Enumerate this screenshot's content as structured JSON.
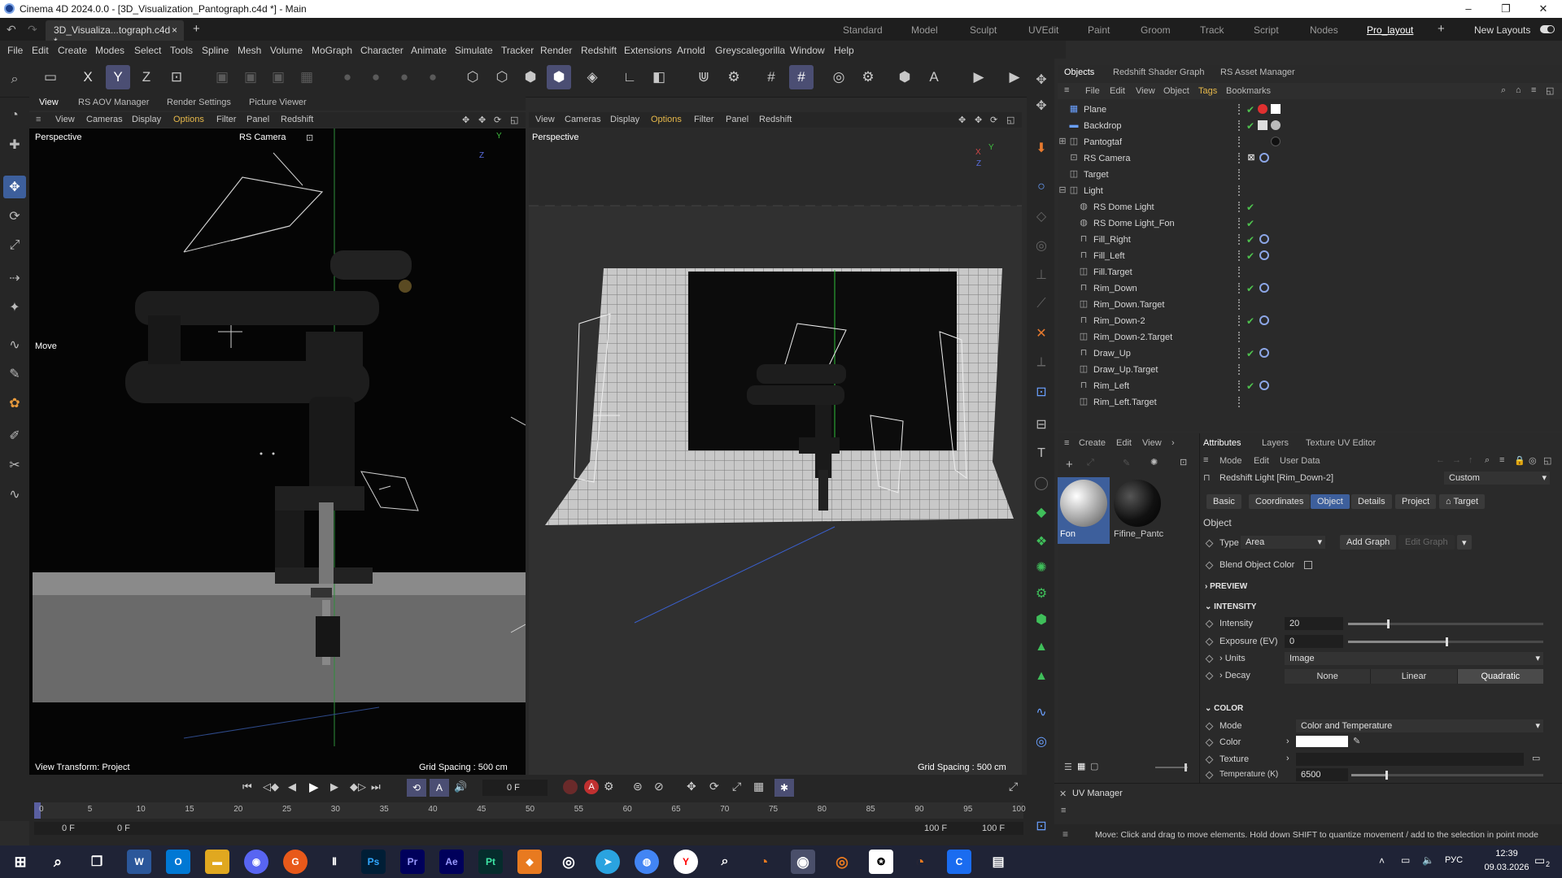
{
  "window": {
    "title": "Cinema 4D 2024.0.0 - [3D_Visualization_Pantograph.c4d *] - Main",
    "minimize": "–",
    "maximize": "❐",
    "close": "✕"
  },
  "tabs": {
    "doc_tab": "3D_Visualiza...tograph.c4d *",
    "close": "×",
    "add": "+",
    "layouts": [
      "Standard",
      "Model",
      "Sculpt",
      "UVEdit",
      "Paint",
      "Groom",
      "Track",
      "Script",
      "Nodes",
      "Pro_layout"
    ],
    "new_layouts": "New Layouts"
  },
  "menu": [
    "File",
    "Edit",
    "Create",
    "Modes",
    "Select",
    "Tools",
    "Spline",
    "Mesh",
    "Volume",
    "MoGraph",
    "Character",
    "Animate",
    "Simulate",
    "Tracker",
    "Render",
    "Redshift",
    "Extensions",
    "Arnold",
    "Greyscalegorilla",
    "Window",
    "Help"
  ],
  "toolbar": {
    "x": "X",
    "y": "Y",
    "z": "Z"
  },
  "view_tabs": [
    "View",
    "RS AOV Manager",
    "Render Settings",
    "Picture Viewer"
  ],
  "viewport_menu": [
    "View",
    "Cameras",
    "Display",
    "Options",
    "Filter",
    "Panel",
    "Redshift"
  ],
  "viewport_left": {
    "label": "Perspective",
    "camera": "RS Camera",
    "hud_move": "Move",
    "view_transform": "View Transform: Project",
    "grid_spacing": "Grid Spacing : 500 cm",
    "axis_y": "Y",
    "axis_z": "Z"
  },
  "viewport_right": {
    "label": "Perspective",
    "grid_spacing": "Grid Spacing : 500 cm",
    "axis_y": "Y",
    "axis_x": "X",
    "axis_z": "Z"
  },
  "objects_panel": {
    "tabs": [
      "Objects",
      "Redshift Shader Graph",
      "RS Asset Manager"
    ],
    "menu": [
      "File",
      "Edit",
      "View",
      "Object",
      "Tags",
      "Bookmarks"
    ],
    "items": [
      {
        "name": "Plane",
        "check": "✔"
      },
      {
        "name": "Backdrop",
        "check": "✔"
      },
      {
        "name": "Pantogtaf",
        "check": ""
      },
      {
        "name": "RS Camera",
        "check": ""
      },
      {
        "name": "Target",
        "check": ""
      },
      {
        "name": "Light",
        "check": ""
      },
      {
        "name": "RS Dome Light",
        "check": "✔"
      },
      {
        "name": "RS Dome Light_Fon",
        "check": "✔"
      },
      {
        "name": "Fill_Right",
        "check": "✔"
      },
      {
        "name": "Fill_Left",
        "check": "✔"
      },
      {
        "name": "Fill.Target",
        "check": ""
      },
      {
        "name": "Rim_Down",
        "check": "✔"
      },
      {
        "name": "Rim_Down.Target",
        "check": ""
      },
      {
        "name": "Rim_Down-2",
        "check": "✔"
      },
      {
        "name": "Rim_Down-2.Target",
        "check": ""
      },
      {
        "name": "Draw_Up",
        "check": "✔"
      },
      {
        "name": "Draw_Up.Target",
        "check": ""
      },
      {
        "name": "Rim_Left",
        "check": "✔"
      },
      {
        "name": "Rim_Left.Target",
        "check": ""
      }
    ]
  },
  "materials": {
    "menu": [
      "Create",
      "Edit",
      "View"
    ],
    "items": [
      {
        "name": "Fon"
      },
      {
        "name": "Fifine_Pantc"
      }
    ]
  },
  "attributes": {
    "tabs": [
      "Attributes",
      "Layers",
      "Texture UV Editor"
    ],
    "menu": [
      "Mode",
      "Edit",
      "User Data"
    ],
    "object_title": "Redshift Light [Rim_Down-2]",
    "preset": "Custom",
    "subtabs": [
      "Basic",
      "Coordinates",
      "Object",
      "Details",
      "Project",
      "Target"
    ],
    "section_object": "Object",
    "type_label": "Type",
    "type_value": "Area",
    "add_graph": "Add Graph",
    "edit_graph": "Edit Graph",
    "blend_label": "Blend Object Color",
    "preview": "PREVIEW",
    "intensity_head": "INTENSITY",
    "intensity_label": "Intensity",
    "intensity_value": "20",
    "intensity_level": 0.2,
    "exposure_label": "Exposure (EV)",
    "exposure_value": "0",
    "exposure_level": 0.5,
    "units_label": "Units",
    "units_value": "Image",
    "decay_label": "Decay",
    "decay_options": [
      "None",
      "Linear",
      "Quadratic"
    ],
    "color_head": "COLOR",
    "mode_label": "Mode",
    "mode_value": "Color and Temperature",
    "color_label": "Color",
    "texture_label": "Texture",
    "temperature_label": "Temperature (K)",
    "temperature_value": "6500",
    "temperature_level": 0.18
  },
  "uv_manager": "UV Manager",
  "timeline": {
    "current_frame": "0 F",
    "start": "0 F",
    "start2": "0 F",
    "end": "100 F",
    "end2": "100 F",
    "ticks": [
      "0",
      "5",
      "10",
      "15",
      "20",
      "25",
      "30",
      "35",
      "40",
      "45",
      "50",
      "55",
      "60",
      "65",
      "70",
      "75",
      "80",
      "85",
      "90",
      "95",
      "100"
    ]
  },
  "status": "Move: Click and drag to move elements. Hold down SHIFT to quantize movement / add to the selection in point mode",
  "taskbar": {
    "lang": "РУС",
    "time": "12:39",
    "date": "09.03.2026",
    "notif": "2"
  }
}
